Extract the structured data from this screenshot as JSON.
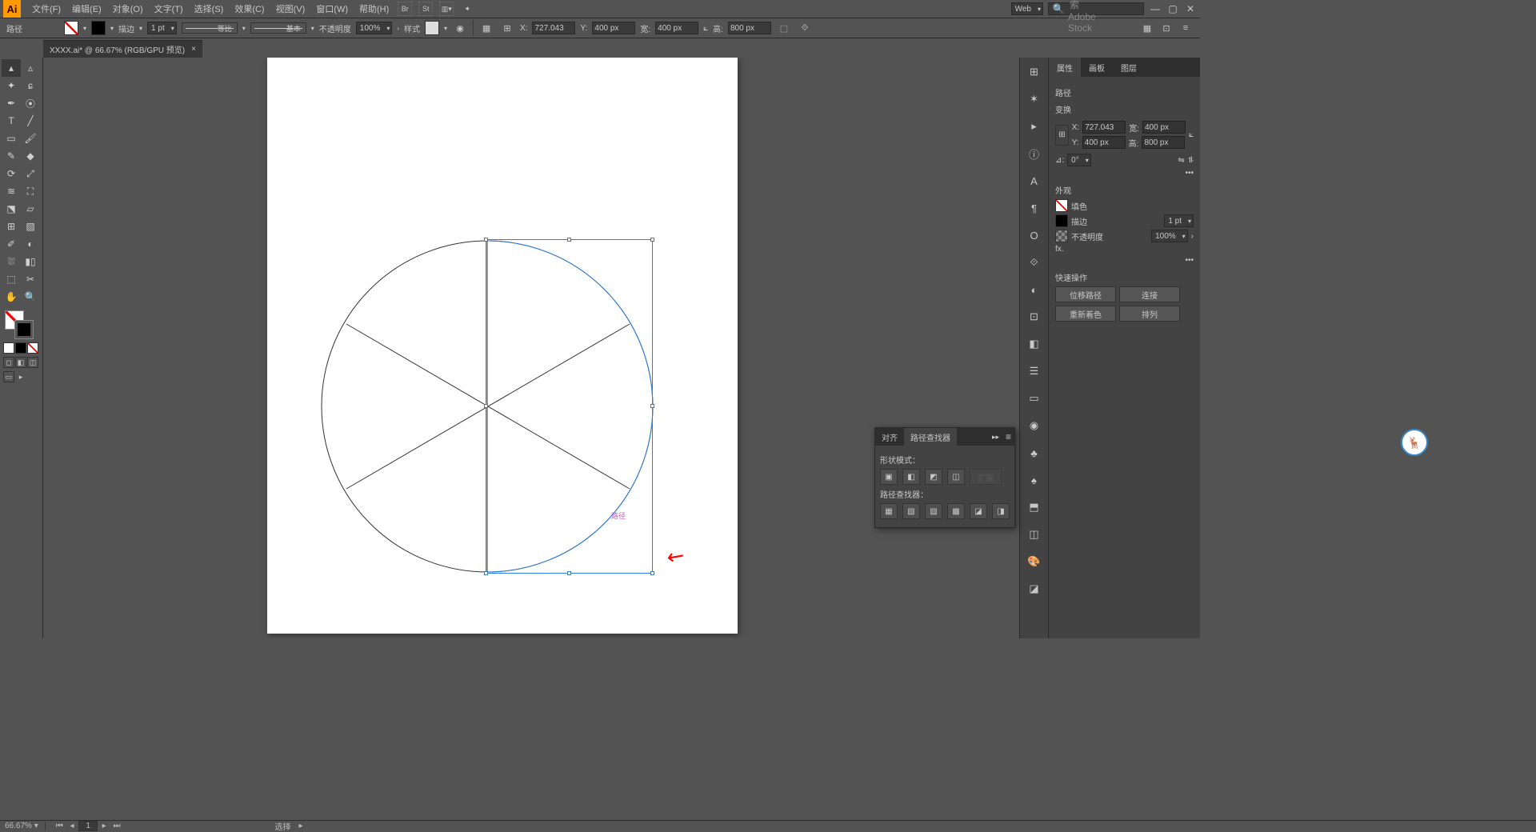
{
  "menubar": {
    "items": [
      "文件(F)",
      "编辑(E)",
      "对象(O)",
      "文字(T)",
      "选择(S)",
      "效果(C)",
      "视图(V)",
      "窗口(W)",
      "帮助(H)"
    ],
    "workspace_label": "Web",
    "search_placeholder": "搜索 Adobe Stock"
  },
  "controlbar": {
    "selection_label": "路径",
    "stroke_label": "描边",
    "stroke_weight": "1 pt",
    "profile_label": "等比",
    "brush_label": "基本",
    "opacity_label": "不透明度",
    "opacity_value": "100%",
    "style_label": "样式",
    "x_label": "X:",
    "x_value": "727.043",
    "y_label": "Y:",
    "y_value": "400 px",
    "w_label": "宽:",
    "w_value": "400 px",
    "h_label": "高:",
    "h_value": "800 px"
  },
  "document": {
    "tab_title": "XXXX.ai* @ 66.67% (RGB/GPU 预览)"
  },
  "canvas": {
    "path_tooltip": "路径"
  },
  "properties": {
    "tabs": [
      "属性",
      "画板",
      "图层"
    ],
    "type_label": "路径",
    "transform_label": "变换",
    "x_label": "X:",
    "x_value": "727.043",
    "y_label": "Y:",
    "y_value": "400 px",
    "w_label": "宽:",
    "w_value": "400 px",
    "h_label": "高:",
    "h_value": "800 px",
    "angle_label": "⊿:",
    "angle_value": "0°",
    "appearance_label": "外观",
    "fill_label": "填色",
    "stroke_label": "描边",
    "stroke_weight": "1 pt",
    "opacity_label": "不透明度",
    "opacity_value": "100%",
    "fx_label": "fx.",
    "quick_label": "快速操作",
    "quick_btns": [
      "位移路径",
      "连接",
      "重新着色",
      "排列"
    ]
  },
  "pathfinder_panel": {
    "tabs": [
      "对齐",
      "路径查找器"
    ],
    "shape_mode_label": "形状模式：",
    "pathfinder_label": "路径查找器：",
    "expand_label": "扩展"
  },
  "statusbar": {
    "zoom": "66.67%",
    "page": "1",
    "tool_label": "选择"
  }
}
